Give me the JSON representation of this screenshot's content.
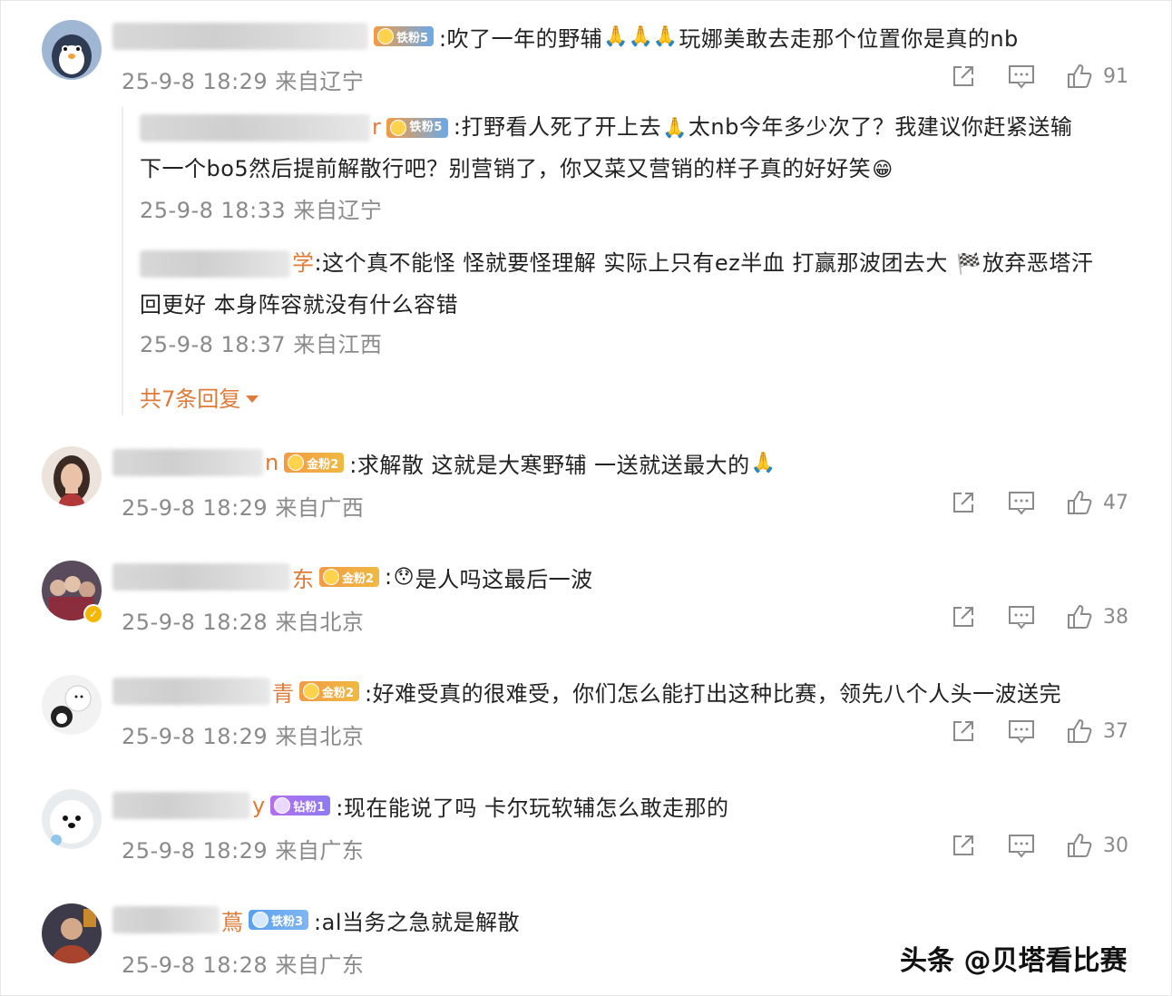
{
  "comments": [
    {
      "name_tail": "",
      "badge": "铁粉5",
      "text_a": ":吹了一年的野辅",
      "text_b": "玩娜美敢去走那个位置你是真的nb",
      "meta": "25-9-8 18:29 来自辽宁",
      "likes": "91",
      "avatar_icon": "penguin-avatar",
      "replies": [
        {
          "name_tail": "r",
          "badge": "铁粉5",
          "text_a": ":打野看人死了开上去",
          "text_b": "太nb今年多少次了？我建议你赶紧送输",
          "text_c": "下一个bo5然后提前解散行吧？别营销了，你又菜又营销的样子真的好好笑",
          "meta": "25-9-8 18:33 来自辽宁"
        },
        {
          "name_tail": "学",
          "text_a": ":这个真不能怪 怪就要怪理解 实际上只有ez半血 打赢那波团去大",
          "text_b": "放弃恶塔汗",
          "text_c": "回更好 本身阵容就没有什么容错",
          "meta": "25-9-8 18:37 来自江西"
        }
      ],
      "more_replies": "共7条回复"
    },
    {
      "name_tail": "n",
      "badge": "金粉2",
      "text": ":求解散 这就是大寒野辅 一送就送最大的",
      "meta": "25-9-8 18:29 来自广西",
      "likes": "47",
      "avatar_icon": "woman-avatar"
    },
    {
      "name_tail": "东",
      "badge": "金粉2",
      "text": "是人吗这最后一波",
      "meta": "25-9-8 18:28 来自北京",
      "likes": "38",
      "avatar_icon": "group-avatar"
    },
    {
      "name_tail": "青",
      "badge": "金粉2",
      "text": ":好难受真的很难受，你们怎么能打出这种比赛，领先八个人头一波送完",
      "meta": "25-9-8 18:29 来自北京",
      "likes": "37",
      "avatar_icon": "bear-avatar"
    },
    {
      "name_tail": "y",
      "badge": "钻粉1",
      "text": ":现在能说了吗 卡尔玩软辅怎么敢走那的",
      "meta": "25-9-8 18:29 来自广东",
      "likes": "30",
      "avatar_icon": "dog-avatar"
    },
    {
      "name_tail": "蔦",
      "badge": "铁粉3",
      "text": ":al当务之急就是解散",
      "meta": "25-9-8 18:28 来自广东",
      "avatar_icon": "portrait-avatar"
    }
  ],
  "watermark": "头条 @贝塔看比赛",
  "colors": {
    "accent": "#e07a38",
    "meta": "#8a8a8a",
    "text": "#222222"
  }
}
